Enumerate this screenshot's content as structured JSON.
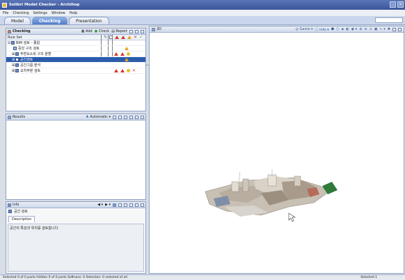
{
  "window": {
    "title": "Solibri Model Checker - Archihop"
  },
  "menu": [
    "File",
    "Checking",
    "Settings",
    "Window",
    "Help"
  ],
  "tabs": [
    "Model",
    "Checking",
    "Presentation"
  ],
  "checking": {
    "title": "Checking",
    "tools": {
      "add": "Add",
      "check": "Check",
      "report": "Report"
    },
    "header": "Rule Set",
    "rows": [
      {
        "label": "BIM 검토 - 종합",
        "indent": 0,
        "expander": "⊟"
      },
      {
        "label": "중앙 구조 검토",
        "indent": 1,
        "expander": ""
      },
      {
        "label": "주변요소와 구조 분할",
        "indent": 1,
        "expander": "⊞"
      },
      {
        "label": "공간검토",
        "indent": 1,
        "expander": "⊞"
      },
      {
        "label": "공간그룹 분석",
        "indent": 1,
        "expander": "⊞"
      },
      {
        "label": "교차부분 검토",
        "indent": 1,
        "expander": "⊞"
      }
    ]
  },
  "results": {
    "title": "Results",
    "mode": "Automatic"
  },
  "info": {
    "title": "Info",
    "item": "공간 검토",
    "tab": "Description",
    "text": "공간의 특성과 위치를 검토합니다."
  },
  "view3d": {
    "title": "3D",
    "tools": {
      "game": "Game",
      "info": "Info"
    }
  },
  "status": {
    "left": "Selected 0 of 0 parts   Hidden 0 of 0 parts   Softness: 0 Selection: 0 selected of all",
    "right": "Selected 1"
  }
}
